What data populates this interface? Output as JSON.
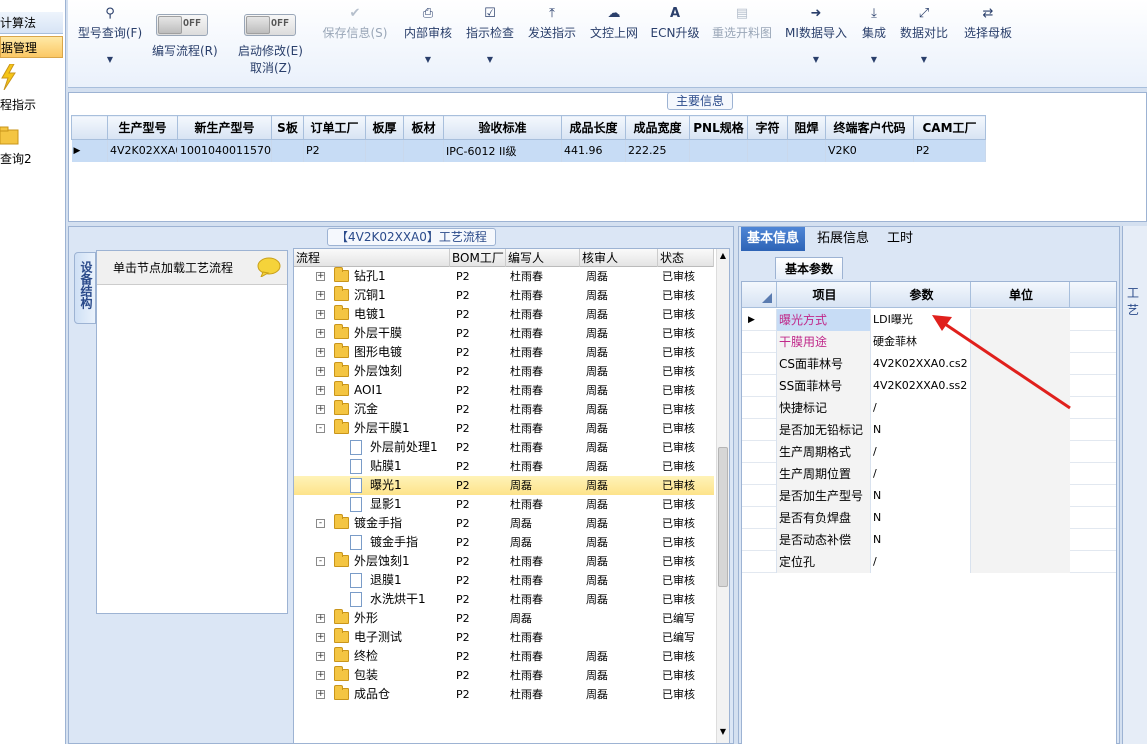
{
  "leftnav": {
    "caption": "计算法",
    "selected": "据管理",
    "item1": "程指示",
    "item2": "查询2"
  },
  "toolbar": {
    "buttons": [
      {
        "label": "型号查询(F)",
        "icon": "search-icon"
      },
      {
        "label": "编写流程(R)",
        "icon": "toggle"
      },
      {
        "label": "启动修改(E)",
        "sub": "取消(Z)",
        "icon": "toggle"
      },
      {
        "label": "保存信息(S)",
        "icon": "check-icon"
      },
      {
        "label": "内部审核",
        "icon": "printer-icon"
      },
      {
        "label": "指示检查",
        "icon": "checklist-icon"
      },
      {
        "label": "发送指示",
        "icon": "upload-icon"
      },
      {
        "label": "文控上网",
        "icon": "cloud-icon"
      },
      {
        "label": "ECN升级",
        "icon": "ecn-icon"
      },
      {
        "label": "重选开料图",
        "icon": "image-icon"
      },
      {
        "label": "MI数据导入",
        "icon": "import-icon"
      },
      {
        "label": "集成",
        "icon": "download-icon"
      },
      {
        "label": "数据对比",
        "icon": "compare-icon"
      },
      {
        "label": "选择母板",
        "icon": "shuffle-icon"
      }
    ],
    "toggle_off": "OFF"
  },
  "main_info": {
    "group_label": "主要信息",
    "columns": [
      "生产型号",
      "新生产型号",
      "S板",
      "订单工厂",
      "板厚",
      "板材",
      "验收标准",
      "成品长度",
      "成品宽度",
      "PNL规格",
      "字符",
      "阻焊",
      "终端客户代码",
      "CAM工厂"
    ],
    "row": [
      "4V2K02XXA0",
      "10010400115708",
      "",
      "P2",
      "",
      "",
      "IPC-6012 II级",
      "441.96",
      "222.25",
      "",
      "",
      "",
      "V2K0",
      "P2"
    ]
  },
  "process": {
    "group_label": "【4V2K02XXA0】工艺流程",
    "side_tab": "设备结构",
    "node_hint": "单击节点加载工艺流程",
    "columns": [
      "流程",
      "BOM工厂",
      "编写人",
      "核审人",
      "状态"
    ],
    "rows": [
      {
        "name": "钻孔1",
        "level": 0,
        "expand": "+",
        "bom": "P2",
        "writer": "杜雨春",
        "reviewer": "周磊",
        "status": "已审核"
      },
      {
        "name": "沉铜1",
        "level": 0,
        "expand": "+",
        "bom": "P2",
        "writer": "杜雨春",
        "reviewer": "周磊",
        "status": "已审核"
      },
      {
        "name": "电镀1",
        "level": 0,
        "expand": "+",
        "bom": "P2",
        "writer": "杜雨春",
        "reviewer": "周磊",
        "status": "已审核"
      },
      {
        "name": "外层干膜",
        "level": 0,
        "expand": "+",
        "bom": "P2",
        "writer": "杜雨春",
        "reviewer": "周磊",
        "status": "已审核"
      },
      {
        "name": "图形电镀",
        "level": 0,
        "expand": "+",
        "bom": "P2",
        "writer": "杜雨春",
        "reviewer": "周磊",
        "status": "已审核"
      },
      {
        "name": "外层蚀刻",
        "level": 0,
        "expand": "+",
        "bom": "P2",
        "writer": "杜雨春",
        "reviewer": "周磊",
        "status": "已审核"
      },
      {
        "name": "AOI1",
        "level": 0,
        "expand": "+",
        "bom": "P2",
        "writer": "杜雨春",
        "reviewer": "周磊",
        "status": "已审核"
      },
      {
        "name": "沉金",
        "level": 0,
        "expand": "+",
        "bom": "P2",
        "writer": "杜雨春",
        "reviewer": "周磊",
        "status": "已审核"
      },
      {
        "name": "外层干膜1",
        "level": 0,
        "expand": "-",
        "bom": "P2",
        "writer": "杜雨春",
        "reviewer": "周磊",
        "status": "已审核"
      },
      {
        "name": "外层前处理1",
        "level": 1,
        "expand": "",
        "bom": "P2",
        "writer": "杜雨春",
        "reviewer": "周磊",
        "status": "已审核"
      },
      {
        "name": "贴膜1",
        "level": 1,
        "expand": "",
        "bom": "P2",
        "writer": "杜雨春",
        "reviewer": "周磊",
        "status": "已审核"
      },
      {
        "name": "曝光1",
        "level": 1,
        "expand": "",
        "bom": "P2",
        "writer": "周磊",
        "reviewer": "周磊",
        "status": "已审核",
        "selected": true
      },
      {
        "name": "显影1",
        "level": 1,
        "expand": "",
        "bom": "P2",
        "writer": "杜雨春",
        "reviewer": "周磊",
        "status": "已审核"
      },
      {
        "name": "镀金手指",
        "level": 0,
        "expand": "-",
        "bom": "P2",
        "writer": "周磊",
        "reviewer": "周磊",
        "status": "已审核"
      },
      {
        "name": "镀金手指",
        "level": 1,
        "expand": "",
        "bom": "P2",
        "writer": "周磊",
        "reviewer": "周磊",
        "status": "已审核"
      },
      {
        "name": "外层蚀刻1",
        "level": 0,
        "expand": "-",
        "bom": "P2",
        "writer": "杜雨春",
        "reviewer": "周磊",
        "status": "已审核"
      },
      {
        "name": "退膜1",
        "level": 1,
        "expand": "",
        "bom": "P2",
        "writer": "杜雨春",
        "reviewer": "周磊",
        "status": "已审核"
      },
      {
        "name": "水洗烘干1",
        "level": 1,
        "expand": "",
        "bom": "P2",
        "writer": "杜雨春",
        "reviewer": "周磊",
        "status": "已审核"
      },
      {
        "name": "外形",
        "level": 0,
        "expand": "+",
        "bom": "P2",
        "writer": "周磊",
        "reviewer": "",
        "status": "已编写"
      },
      {
        "name": "电子测试",
        "level": 0,
        "expand": "+",
        "bom": "P2",
        "writer": "杜雨春",
        "reviewer": "",
        "status": "已编写"
      },
      {
        "name": "终检",
        "level": 0,
        "expand": "+",
        "bom": "P2",
        "writer": "杜雨春",
        "reviewer": "周磊",
        "status": "已审核"
      },
      {
        "name": "包装",
        "level": 0,
        "expand": "+",
        "bom": "P2",
        "writer": "杜雨春",
        "reviewer": "周磊",
        "status": "已审核"
      },
      {
        "name": "成品仓",
        "level": 0,
        "expand": "+",
        "bom": "P2",
        "writer": "杜雨春",
        "reviewer": "周磊",
        "status": "已审核"
      }
    ]
  },
  "right": {
    "tabs": [
      "基本信息",
      "拓展信息",
      "工时"
    ],
    "sub_tab": "基本参数",
    "columns": [
      "项目",
      "参数",
      "单位"
    ],
    "far_right_label": "工艺",
    "rows": [
      {
        "item": "曝光方式",
        "value": "LDI曝光",
        "unit": "",
        "highlight": true
      },
      {
        "item": "干膜用途",
        "value": "硬金菲林",
        "unit": "",
        "highlight": true
      },
      {
        "item": "CS面菲林号",
        "value": "4V2K02XXA0.cs2",
        "unit": ""
      },
      {
        "item": "SS面菲林号",
        "value": "4V2K02XXA0.ss2",
        "unit": ""
      },
      {
        "item": "快捷标记",
        "value": "/",
        "unit": ""
      },
      {
        "item": "是否加无铅标记",
        "value": "N",
        "unit": ""
      },
      {
        "item": "生产周期格式",
        "value": "/",
        "unit": ""
      },
      {
        "item": "生产周期位置",
        "value": "/",
        "unit": ""
      },
      {
        "item": "是否加生产型号",
        "value": "N",
        "unit": ""
      },
      {
        "item": "是否有负焊盘",
        "value": "N",
        "unit": ""
      },
      {
        "item": "是否动态补偿",
        "value": "N",
        "unit": ""
      },
      {
        "item": "定位孔",
        "value": "/",
        "unit": ""
      }
    ]
  },
  "colors": {
    "highlight_text": "#c0288a",
    "arrow": "#e0201c",
    "selected_row": "#fde38a"
  }
}
